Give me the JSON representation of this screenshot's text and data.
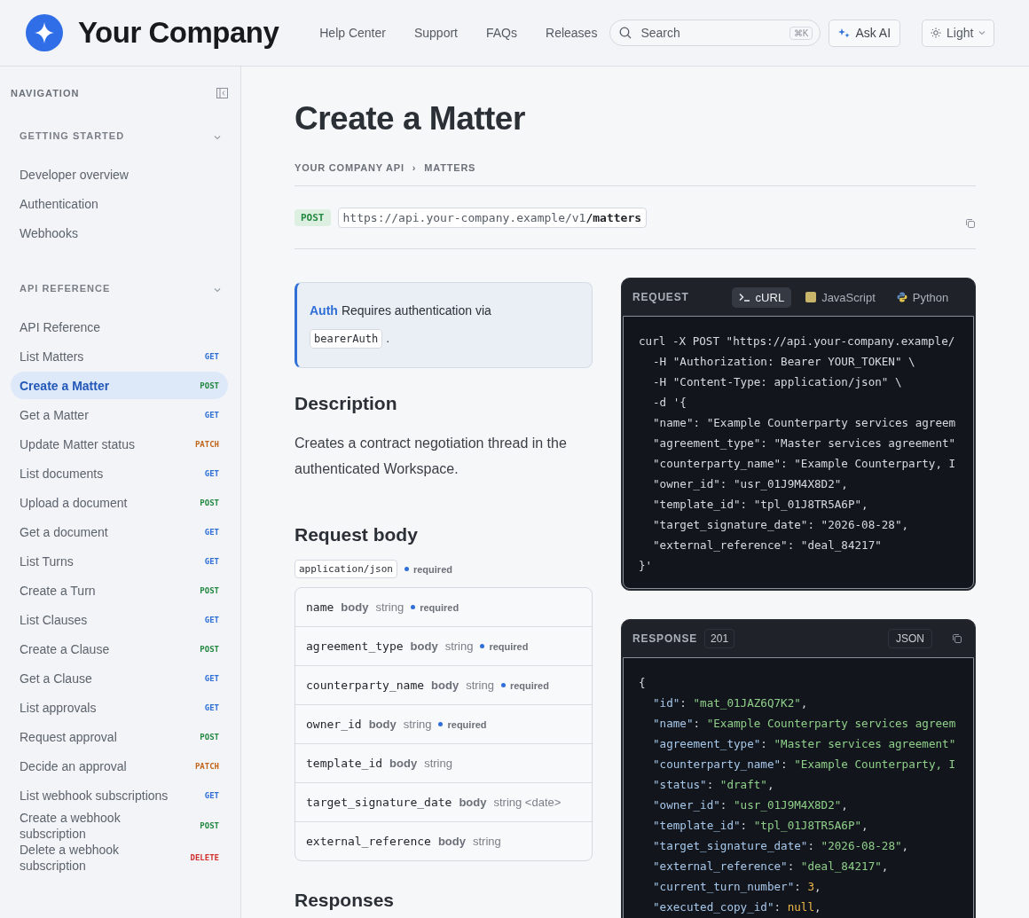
{
  "header": {
    "brand": "Your Company",
    "nav": [
      "Help Center",
      "Support",
      "FAQs",
      "Releases"
    ],
    "search": {
      "placeholder": "Search",
      "shortcut": "⌘K"
    },
    "ask_ai": "Ask AI",
    "theme": "Light"
  },
  "sidebar": {
    "title": "NAVIGATION",
    "sections": [
      {
        "title": "GETTING STARTED",
        "expanded": true,
        "items": [
          {
            "label": "Developer overview",
            "selected": false
          },
          {
            "label": "Authentication",
            "selected": false
          },
          {
            "label": "Webhooks",
            "selected": false
          }
        ]
      },
      {
        "title": "API REFERENCE",
        "expanded": true,
        "items": [
          {
            "label": "API Reference",
            "selected": false
          },
          {
            "label": "List Matters",
            "method": "GET",
            "color": "#2f6fd6",
            "selected": false
          },
          {
            "label": "Create a Matter",
            "method": "POST",
            "color": "#23883f",
            "selected": true
          },
          {
            "label": "Get a Matter",
            "method": "GET",
            "color": "#2f6fd6",
            "selected": false
          },
          {
            "label": "Update Matter status",
            "method": "PATCH",
            "color": "#c2661b",
            "selected": false
          },
          {
            "label": "List documents",
            "method": "GET",
            "color": "#2f6fd6",
            "selected": false
          },
          {
            "label": "Upload a document",
            "method": "POST",
            "color": "#23883f",
            "selected": false
          },
          {
            "label": "Get a document",
            "method": "GET",
            "color": "#2f6fd6",
            "selected": false
          },
          {
            "label": "List Turns",
            "method": "GET",
            "color": "#2f6fd6",
            "selected": false
          },
          {
            "label": "Create a Turn",
            "method": "POST",
            "color": "#23883f",
            "selected": false
          },
          {
            "label": "List Clauses",
            "method": "GET",
            "color": "#2f6fd6",
            "selected": false
          },
          {
            "label": "Create a Clause",
            "method": "POST",
            "color": "#23883f",
            "selected": false
          },
          {
            "label": "Get a Clause",
            "method": "GET",
            "color": "#2f6fd6",
            "selected": false
          },
          {
            "label": "List approvals",
            "method": "GET",
            "color": "#2f6fd6",
            "selected": false
          },
          {
            "label": "Request approval",
            "method": "POST",
            "color": "#23883f",
            "selected": false
          },
          {
            "label": "Decide an approval",
            "method": "PATCH",
            "color": "#c2661b",
            "selected": false
          },
          {
            "label": "List webhook subscriptions",
            "method": "GET",
            "color": "#2f6fd6",
            "selected": false
          },
          {
            "label": "Create a webhook subscription",
            "method": "POST",
            "color": "#23883f",
            "selected": false
          },
          {
            "label": "Delete a webhook subscription",
            "method": "DELETE",
            "color": "#d0312d",
            "selected": false
          }
        ]
      }
    ]
  },
  "page": {
    "title": "Create a Matter",
    "breadcrumb": [
      "YOUR COMPANY API",
      "MATTERS"
    ],
    "breadcrumb_separator": "›",
    "endpoint": {
      "method": "POST",
      "url": "https://api.your-company.example/v1**/matters**"
    },
    "auth": {
      "label": "Auth",
      "text": "Requires authentication via",
      "scheme": "bearerAuth",
      "end": "."
    },
    "description": {
      "heading": "Description",
      "text": "Creates a contract negotiation thread in the authenticated Workspace."
    },
    "request_body": {
      "heading": "Request body",
      "content_type": "application/json",
      "required": "required",
      "params": [
        {
          "name": "name",
          "location": "body",
          "type": "string",
          "required": "required"
        },
        {
          "name": "agreement_type",
          "location": "body",
          "type": "string",
          "required": "required"
        },
        {
          "name": "counterparty_name",
          "location": "body",
          "type": "string",
          "required": "required"
        },
        {
          "name": "owner_id",
          "location": "body",
          "type": "string",
          "required": "required"
        },
        {
          "name": "template_id",
          "location": "body",
          "type": "string"
        },
        {
          "name": "target_signature_date",
          "location": "body",
          "type": "string <date>"
        },
        {
          "name": "external_reference",
          "location": "body",
          "type": "string"
        }
      ]
    },
    "responses_heading": "Responses"
  },
  "request_panel": {
    "label": "REQUEST",
    "tabs": [
      {
        "label": "cURL",
        "kind": "terminal",
        "selected": true
      },
      {
        "label": "JavaScript",
        "kind": "js",
        "selected": false
      },
      {
        "label": "Python",
        "kind": "python",
        "selected": false
      }
    ],
    "lines": [
      {
        "kind": "command",
        "text": "curl -X POST \"https://api.your-company.example/"
      },
      {
        "kind": "option",
        "text": "-H \"Authorization: Bearer YOUR_TOKEN\" \\"
      },
      {
        "kind": "option",
        "text": "-H \"Content-Type: application/json\" \\"
      },
      {
        "kind": "option",
        "text": "-d '{"
      },
      {
        "kind": "option",
        "text": "\"name\": \"Example Counterparty services agreem"
      },
      {
        "kind": "option",
        "text": "\"agreement_type\": \"Master services agreement\""
      },
      {
        "kind": "option",
        "text": "\"counterparty_name\": \"Example Counterparty, I"
      },
      {
        "kind": "option",
        "text": "\"owner_id\": \"usr_01J9M4X8D2\","
      },
      {
        "kind": "option",
        "text": "\"template_id\": \"tpl_01J8TR5A6P\","
      },
      {
        "kind": "option",
        "text": "\"target_signature_date\": \"2026-08-28\","
      },
      {
        "kind": "option",
        "text": "\"external_reference\": \"deal_84217\""
      },
      {
        "kind": "command",
        "text": "}'"
      }
    ]
  },
  "response_panel": {
    "label": "RESPONSE",
    "status": "201",
    "format": "JSON",
    "lines": [
      {
        "kind": "brace",
        "text": "{"
      },
      {
        "kind": "string_field",
        "key": "\"id\"",
        "colon": ": ",
        "value": "\"mat_01JAZ6Q7K2\"",
        "comma": ","
      },
      {
        "kind": "string_field",
        "key": "\"name\"",
        "colon": ": ",
        "value": "\"Example Counterparty services agreem"
      },
      {
        "kind": "string_field",
        "key": "\"agreement_type\"",
        "colon": ": ",
        "value": "\"Master services agreement\""
      },
      {
        "kind": "string_field",
        "key": "\"counterparty_name\"",
        "colon": ": ",
        "value": "\"Example Counterparty, I"
      },
      {
        "kind": "string_field",
        "key": "\"status\"",
        "colon": ": ",
        "value": "\"draft\"",
        "comma": ","
      },
      {
        "kind": "string_field",
        "key": "\"owner_id\"",
        "colon": ": ",
        "value": "\"usr_01J9M4X8D2\"",
        "comma": ","
      },
      {
        "kind": "string_field",
        "key": "\"template_id\"",
        "colon": ": ",
        "value": "\"tpl_01J8TR5A6P\"",
        "comma": ","
      },
      {
        "kind": "string_field",
        "key": "\"target_signature_date\"",
        "colon": ": ",
        "value": "\"2026-08-28\"",
        "comma": ","
      },
      {
        "kind": "string_field",
        "key": "\"external_reference\"",
        "colon": ": ",
        "value": "\"deal_84217\"",
        "comma": ","
      },
      {
        "kind": "number_field",
        "key": "\"current_turn_number\"",
        "colon": ": ",
        "value": "3",
        "comma": ","
      },
      {
        "kind": "null_field",
        "key": "\"executed_copy_id\"",
        "colon": ": ",
        "value": "null",
        "comma": ","
      }
    ]
  }
}
